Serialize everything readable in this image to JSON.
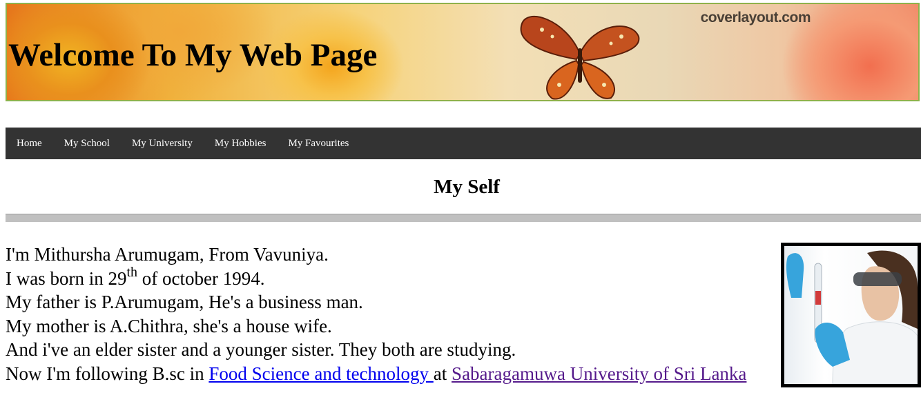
{
  "banner": {
    "title": "Welcome To My Web Page",
    "watermark": "coverlayout.com"
  },
  "nav": {
    "items": [
      {
        "label": "Home"
      },
      {
        "label": "My School"
      },
      {
        "label": "My University"
      },
      {
        "label": "My Hobbies"
      },
      {
        "label": "My Favourites"
      }
    ]
  },
  "section": {
    "title": "My Self"
  },
  "bio": {
    "line1": "I'm Mithursha Arumugam, From Vavuniya.",
    "line2_prefix": "I was born in 29",
    "line2_sup": "th",
    "line2_suffix": " of october 1994.",
    "line3": "My father is P.Arumugam, He's a business man.",
    "line4": "My mother is A.Chithra, she's a house wife.",
    "line5": "And i've an elder sister and a younger sister. They both are studying.",
    "line6_prefix": "Now I'm following B.sc in ",
    "line6_link1": "Food Science and technology ",
    "line6_middle": "at ",
    "line6_link2": "Sabaragamuwa University of Sri Lanka"
  },
  "colors": {
    "nav_bg": "#333333",
    "link": "#0000ee",
    "visited_link": "#551a8b",
    "banner_border": "#8fb14a"
  }
}
